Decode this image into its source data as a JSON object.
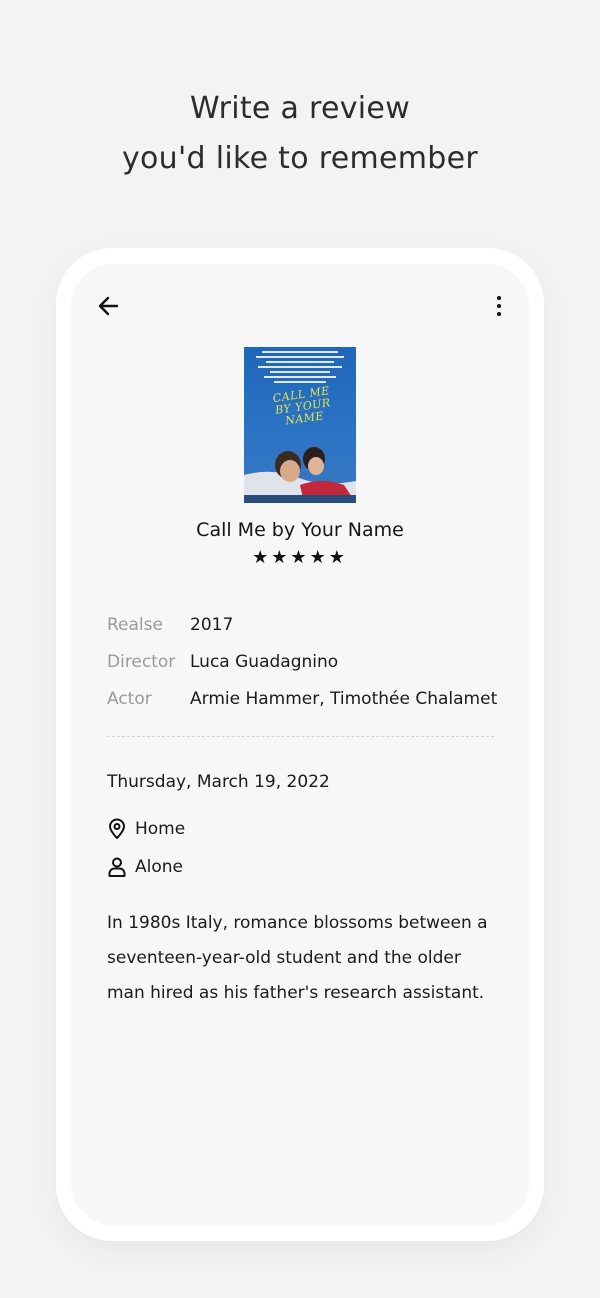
{
  "headline": {
    "line1": "Write a review",
    "line2": "you'd like to remember"
  },
  "movie": {
    "poster_title": "CALL ME BY YOUR NAME",
    "title": "Call Me by Your Name",
    "rating_stars": "★★★★★",
    "rating": 5,
    "details": [
      {
        "label": "Realse",
        "value": "2017"
      },
      {
        "label": "Director",
        "value": "Luca Guadagnino"
      },
      {
        "label": "Actor",
        "value": "Armie Hammer, Timothée Chalamet"
      }
    ]
  },
  "entry": {
    "date": "Thursday, March 19, 2022",
    "location": "Home",
    "company": "Alone",
    "review": "In 1980s Italy, romance blossoms between a seventeen-year-old student and the older man hired as his father's research assistant."
  },
  "icons": {
    "back": "arrow-left-icon",
    "more": "more-vertical-icon",
    "location": "map-pin-icon",
    "company": "person-icon"
  },
  "colors": {
    "background": "#f3f3f4",
    "poster_blue": "#2b73c4",
    "poster_title": "#e4e64c"
  }
}
